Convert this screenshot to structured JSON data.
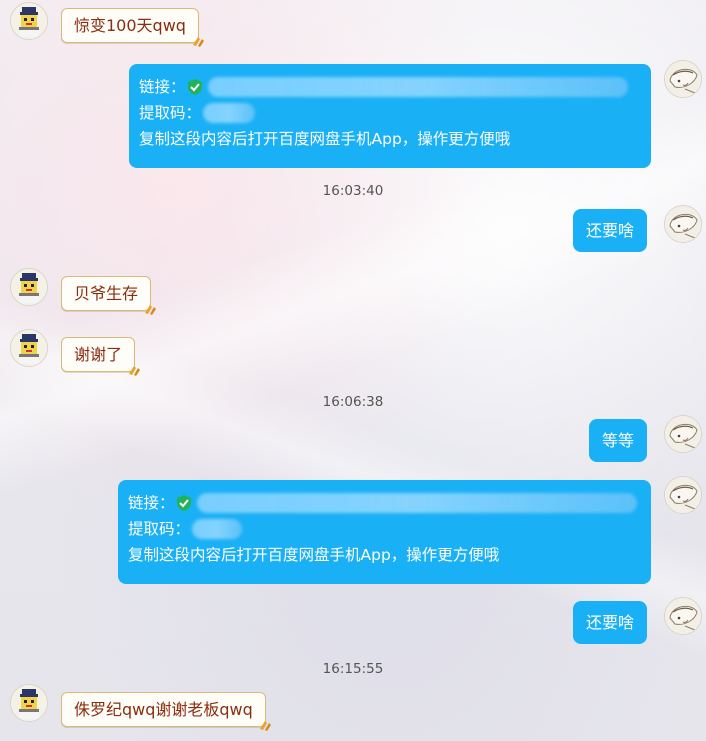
{
  "messages": {
    "m1": "惊变100天qwq",
    "m2_link_label": "链接：",
    "m2_code_label": "提取码：",
    "m2_hint": "复制这段内容后打开百度网盘手机App，操作更方便哦",
    "m3": "还要啥",
    "m4": "贝爷生存",
    "m5": "谢谢了",
    "m6": "等等",
    "m7_link_label": "链接：",
    "m7_code_label": "提取码：",
    "m7_hint": "复制这段内容后打开百度网盘手机App，操作更方便哦",
    "m8": "还要啥",
    "m9": "侏罗纪qwq谢谢老板qwq"
  },
  "timestamps": {
    "t1": "16:03:40",
    "t2": "16:06:38",
    "t3": "16:15:55"
  },
  "colors": {
    "self_bubble": "#1ab0f5",
    "other_bubble_bg": "#fffdf7",
    "other_bubble_border": "#d9b97a",
    "other_text": "#8a2d10",
    "check": "#22b35a"
  },
  "icons": {
    "left_avatar": "pixel-character-avatar",
    "right_avatar": "sketch-character-avatar",
    "check": "green-check-shield-icon",
    "bubble_deco": "paw-decoration-icon"
  }
}
